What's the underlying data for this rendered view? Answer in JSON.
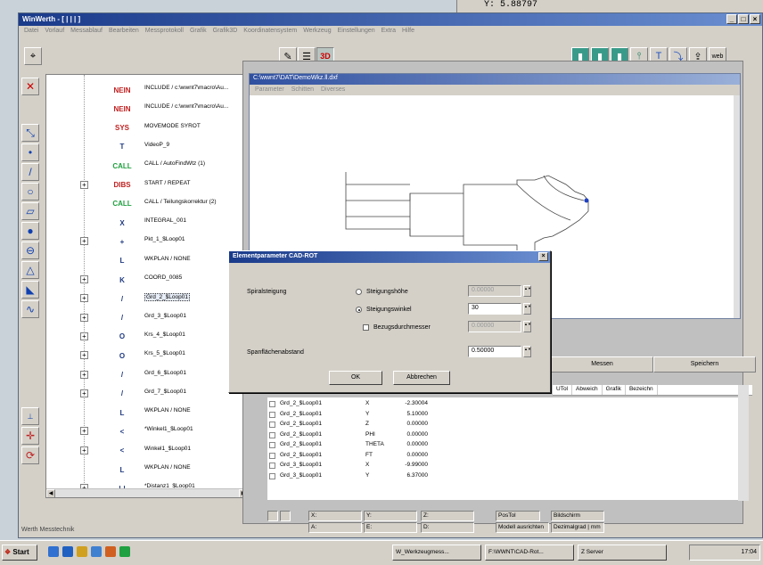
{
  "outer_fragment": {
    "text": "Y: 5.88797"
  },
  "window": {
    "title": "WinWerth - [ | | | ]",
    "controls": [
      "_",
      "□",
      "×"
    ],
    "menu": [
      "Datei",
      "Vorlauf",
      "Messablauf",
      "Bearbeiten",
      "Messprotokoll",
      "Grafik",
      "Grafik3D",
      "Koordinatensystem",
      "Werkzeug",
      "Einstellungen",
      "Extra",
      "Hilfe"
    ]
  },
  "toolbar": {
    "label_3d": "3D",
    "label_web": "web"
  },
  "tree": {
    "items": [
      {
        "icon": "NEIN",
        "label": "INCLUDE / c:\\wwnt7\\macro\\Au..."
      },
      {
        "icon": "NEIN",
        "label": "INCLUDE / c:\\wwnt7\\macro\\Au..."
      },
      {
        "icon": "SYS",
        "label": "MOVEMODE SYROT"
      },
      {
        "icon": "T",
        "label": "VideoP_9"
      },
      {
        "icon": "CALL",
        "label": "CALL / AutoFindWtz (1)"
      },
      {
        "icon": "DIBS",
        "label": "START / REPEAT"
      },
      {
        "icon": "CALL",
        "label": "CALL / Teilungskorrektur (2)"
      },
      {
        "icon": "X",
        "label": "INTEGRAL_001"
      },
      {
        "icon": "+",
        "label": "Pkt_1_$Loop01"
      },
      {
        "icon": "L",
        "label": "WKPLAN / NONE"
      },
      {
        "icon": "K",
        "label": "COORD_0085"
      },
      {
        "icon": "/",
        "label": "Grd_2_$Loop01"
      },
      {
        "icon": "/",
        "label": "Grd_3_$Loop01"
      },
      {
        "icon": "O",
        "label": "Krs_4_$Loop01"
      },
      {
        "icon": "O",
        "label": "Krs_5_$Loop01"
      },
      {
        "icon": "/",
        "label": "Grd_6_$Loop01"
      },
      {
        "icon": "/",
        "label": "Grd_7_$Loop01"
      },
      {
        "icon": "L",
        "label": "WKPLAN / NONE"
      },
      {
        "icon": "<",
        "label": "*Winkel1_$Loop01"
      },
      {
        "icon": "<",
        "label": "Winkel1_$Loop01"
      },
      {
        "icon": "L",
        "label": "WKPLAN / NONE"
      },
      {
        "icon": "|-|",
        "label": "*Distanz1_$Loop01"
      }
    ]
  },
  "cad_window": {
    "title": "C:\\wwnt7\\DAT\\DemoWkz.ll.dxf",
    "menu": [
      "Parameter",
      "Schitten",
      "Diverses"
    ]
  },
  "dialog": {
    "title": "Elementparameter CAD-ROT",
    "close": "×",
    "label_spiral": "Spiralsteigung",
    "opt_height": "Steigungshöhe",
    "opt_angle": "Steigungswinkel",
    "opt_ref_dia": "Bezugsdurchmesser",
    "val_height": "0.00000",
    "val_angle": "30",
    "val_ref_dia": "0.00000",
    "label_flank": "Spanflächenabstand",
    "val_flank": "0.50000",
    "ok": "OK",
    "cancel": "Abbrechen"
  },
  "measure_tabs": [
    "Messen",
    "Speichern"
  ],
  "columns": [
    "UTol",
    "Abweich",
    "Grafik",
    "Bezeichn"
  ],
  "data_rows": [
    {
      "name": "Grd_2_$Loop01",
      "axis": "X",
      "value": "-2.30004"
    },
    {
      "name": "Grd_2_$Loop01",
      "axis": "Y",
      "value": "5.10000"
    },
    {
      "name": "Grd_2_$Loop01",
      "axis": "Z",
      "value": "0.00000"
    },
    {
      "name": "Grd_2_$Loop01",
      "axis": "PHI",
      "value": "0.00000"
    },
    {
      "name": "Grd_2_$Loop01",
      "axis": "THETA",
      "value": "0.00000"
    },
    {
      "name": "Grd_2_$Loop01",
      "axis": "FT",
      "value": "0.00000"
    },
    {
      "name": "Grd_3_$Loop01",
      "axis": "X",
      "value": "-9.99000"
    },
    {
      "name": "Grd_3_$Loop01",
      "axis": "Y",
      "value": "6.37000"
    }
  ],
  "coords": {
    "x": "X:",
    "y": "Y:",
    "z": "Z:",
    "a": "A:",
    "e": "E:",
    "d": "D:",
    "postol": "PosTol",
    "bild": "Bildschirm",
    "modell": "Modell ausrichten",
    "dezimal": "Dezimalgrad | mm"
  },
  "status": {
    "company": "Werth Messtechnik"
  },
  "taskbar": {
    "start": "Start",
    "tasks": [
      "W_Werkzeugmess...",
      "F:\\WWNT\\CAD-Rot...",
      "Z Server"
    ],
    "clock": "17:04"
  }
}
